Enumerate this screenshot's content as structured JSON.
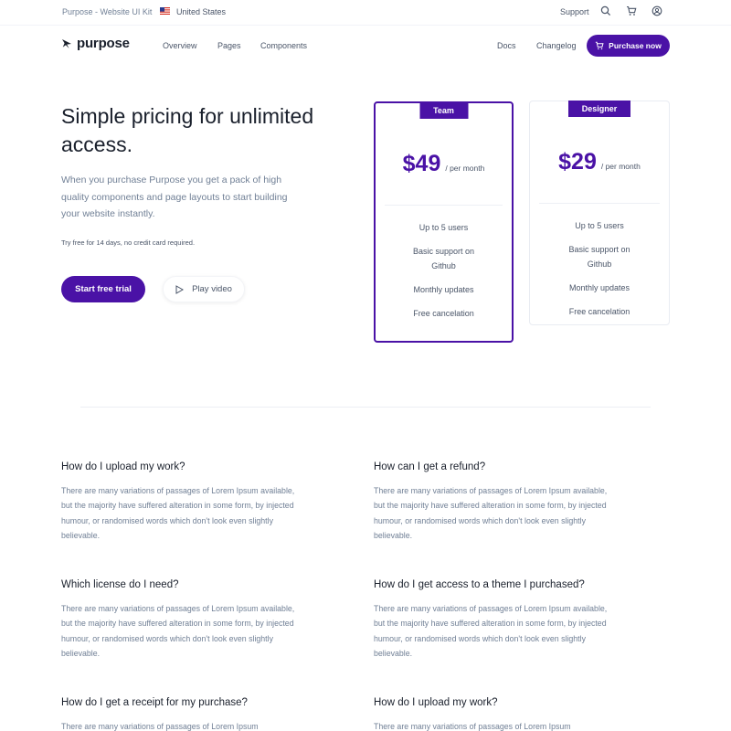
{
  "topbar": {
    "kit_label": "Purpose - Website UI Kit",
    "country": "United States",
    "support": "Support",
    "icons": [
      "search-icon",
      "cart-icon",
      "user-circle-icon"
    ]
  },
  "nav": {
    "logo": "purpose",
    "links": [
      "Overview",
      "Pages",
      "Components"
    ],
    "right_links": [
      "Docs",
      "Changelog"
    ],
    "purchase": "Purchase now"
  },
  "hero": {
    "title": "Simple pricing for unlimited access.",
    "description": "When you purchase Purpose you get a pack of high quality components and page layouts to start building your website instantly.",
    "note": "Try free for 14 days, no credit card required.",
    "trial_button": "Start free trial",
    "video_button": "Play video"
  },
  "pricing": [
    {
      "name": "Team",
      "price": "$49",
      "period": "/ per month",
      "features": [
        "Up to 5 users",
        "Basic support on Github",
        "Monthly updates",
        "Free cancelation"
      ]
    },
    {
      "name": "Designer",
      "price": "$29",
      "period": "/ per month",
      "features": [
        "Up to 5 users",
        "Basic support on Github",
        "Monthly updates",
        "Free cancelation"
      ]
    }
  ],
  "faq": [
    {
      "q": "How do I upload my work?",
      "a": "There are many variations of passages of Lorem Ipsum available, but the majority have suffered alteration in some form, by injected humour, or randomised words which don't look even slightly believable."
    },
    {
      "q": "How can I get a refund?",
      "a": "There are many variations of passages of Lorem Ipsum available, but the majority have suffered alteration in some form, by injected humour, or randomised words which don't look even slightly believable."
    },
    {
      "q": "Which license do I need?",
      "a": "There are many variations of passages of Lorem Ipsum available, but the majority have suffered alteration in some form, by injected humour, or randomised words which don't look even slightly believable."
    },
    {
      "q": "How do I get access to a theme I purchased?",
      "a": "There are many variations of passages of Lorem Ipsum available, but the majority have suffered alteration in some form, by injected humour, or randomised words which don't look even slightly believable."
    },
    {
      "q": "How do I get a receipt for my purchase?",
      "a": "There are many variations of passages of Lorem Ipsum"
    },
    {
      "q": "How do I upload my work?",
      "a": "There are many variations of passages of Lorem Ipsum"
    }
  ],
  "colors": {
    "primary": "#4a12a6",
    "heading": "#1a202c",
    "body_text": "#718096"
  }
}
